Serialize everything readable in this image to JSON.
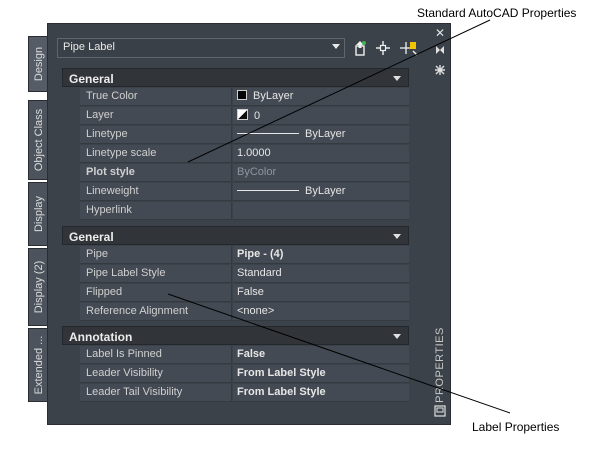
{
  "palette": {
    "tabs": [
      "Design",
      "Object Class",
      "Display",
      "Display (2)",
      "Extended ..."
    ],
    "active_tab": "Design",
    "title": "PROPERTIES",
    "sidebar_icons": [
      "close-icon",
      "auto-hide-icon",
      "settings-icon",
      "properties-icon"
    ]
  },
  "combo": {
    "value": "Pipe Label"
  },
  "toolbar_icons": [
    "toggle-pickadd-icon",
    "select-objects-icon",
    "quick-select-icon"
  ],
  "sections": [
    {
      "title": "General",
      "rows": [
        {
          "name": "True Color",
          "value": "ByLayer",
          "icon": "color-swatch"
        },
        {
          "name": "Layer",
          "value": "0",
          "icon": "layer-icon"
        },
        {
          "name": "Linetype",
          "value": "ByLayer",
          "icon": "linetype-line"
        },
        {
          "name": "Linetype scale",
          "value": "1.0000"
        },
        {
          "name": "Plot style",
          "value": "ByColor",
          "value_dimmed": true,
          "name_bold": true
        },
        {
          "name": "Lineweight",
          "value": "ByLayer",
          "icon": "linetype-line"
        },
        {
          "name": "Hyperlink",
          "value": ""
        }
      ]
    },
    {
      "title": "General",
      "rows": [
        {
          "name": "Pipe",
          "value": "Pipe - (4)",
          "value_bold": true
        },
        {
          "name": "Pipe Label Style",
          "value": "Standard"
        },
        {
          "name": "Flipped",
          "value": "False"
        },
        {
          "name": "Reference Alignment",
          "value": "<none>"
        }
      ]
    },
    {
      "title": "Annotation",
      "rows": [
        {
          "name": "Label Is Pinned",
          "value": "False",
          "value_bold": true
        },
        {
          "name": "Leader Visibility",
          "value": "From Label Style",
          "value_bold": true
        },
        {
          "name": "Leader Tail Visibility",
          "value": "From Label Style",
          "value_bold": true
        }
      ]
    }
  ],
  "annotations": {
    "top": "Standard AutoCAD Properties",
    "bottom": "Label Properties"
  },
  "colors": {
    "panel": "#3c424a",
    "row": "#444a53",
    "category": "#313539",
    "leader": "#000000"
  }
}
